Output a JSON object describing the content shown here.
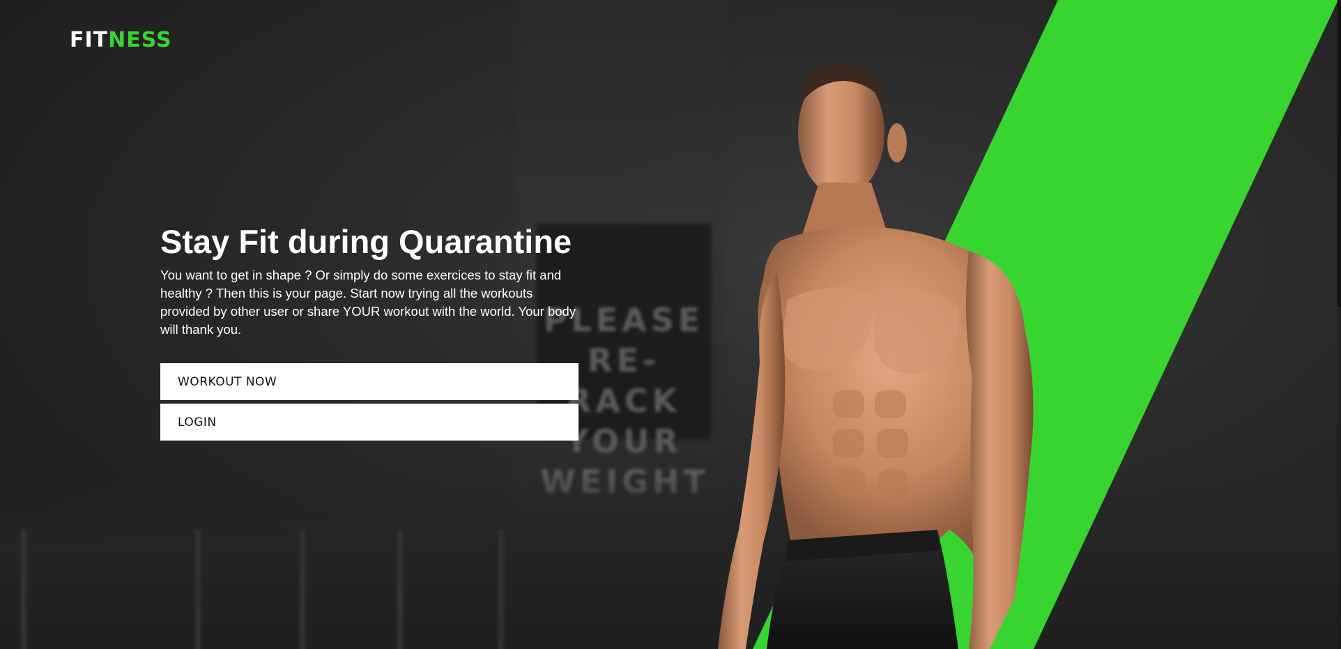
{
  "brand": {
    "part1": "FIT",
    "part2": "NESS",
    "accent_color": "#38d430"
  },
  "hero": {
    "title": "Stay Fit during Quarantine",
    "description": "You want to get in shape ? Or simply do some exercices to stay fit and healthy ? Then this is your page. Start now trying all the workouts provided by other user or share YOUR workout with the world. Your body will thank you.",
    "buttons": {
      "workout": "WORKOUT NOW",
      "login": "LOGIN"
    }
  },
  "background": {
    "sign_text": "PLEASE RE-RACK YOUR WEIGHT"
  },
  "colors": {
    "background": "#232323",
    "stripe": "#38d430",
    "button": "#ffffff",
    "text": "#ffffff"
  }
}
